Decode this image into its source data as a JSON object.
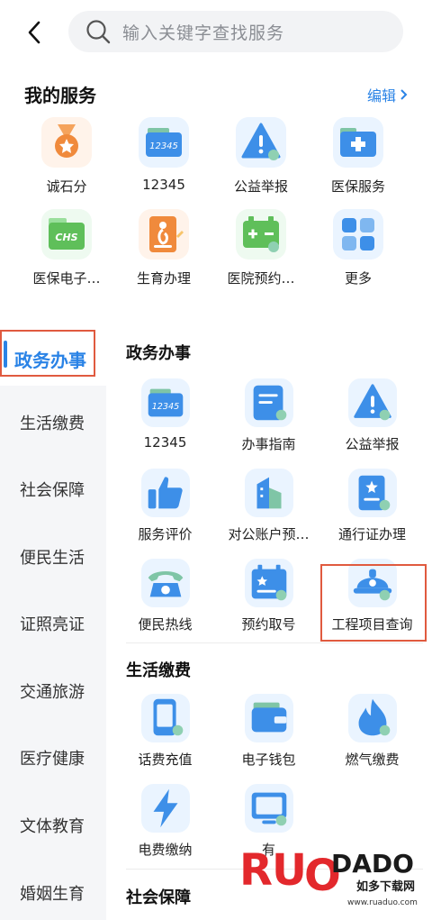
{
  "search": {
    "placeholder": "输入关键字查找服务"
  },
  "my_services": {
    "title": "我的服务",
    "edit_label": "编辑",
    "items": [
      {
        "label": "诚石分",
        "icon": "medal-icon"
      },
      {
        "label": "12345",
        "icon": "hotline-folder-icon"
      },
      {
        "label": "公益举报",
        "icon": "warning-icon"
      },
      {
        "label": "医保服务",
        "icon": "medical-insurance-icon"
      },
      {
        "label": "医保电子…",
        "icon": "chs-card-icon"
      },
      {
        "label": "生育办理",
        "icon": "pregnancy-icon"
      },
      {
        "label": "医院预约…",
        "icon": "battery-calendar-icon"
      },
      {
        "label": "更多",
        "icon": "grid-more-icon"
      }
    ]
  },
  "categories": {
    "active": "政务办事",
    "items": [
      "生活缴费",
      "社会保障",
      "便民生活",
      "证照亮证",
      "交通旅游",
      "医疗健康",
      "文体教育",
      "婚姻生育"
    ]
  },
  "sections": [
    {
      "title": "政务办事",
      "items": [
        {
          "label": "12345",
          "icon": "hotline-folder-icon"
        },
        {
          "label": "办事指南",
          "icon": "guide-doc-icon"
        },
        {
          "label": "公益举报",
          "icon": "warning-icon"
        },
        {
          "label": "服务评价",
          "icon": "thumbs-up-icon"
        },
        {
          "label": "对公账户预…",
          "icon": "building-icon"
        },
        {
          "label": "通行证办理",
          "icon": "pass-card-icon"
        },
        {
          "label": "便民热线",
          "icon": "telephone-icon"
        },
        {
          "label": "预约取号",
          "icon": "calendar-star-icon"
        },
        {
          "label": "工程项目查询",
          "icon": "engineering-helmet-icon"
        }
      ]
    },
    {
      "title": "生活缴费",
      "items": [
        {
          "label": "话费充值",
          "icon": "phone-recharge-icon"
        },
        {
          "label": "电子钱包",
          "icon": "wallet-icon"
        },
        {
          "label": "燃气缴费",
          "icon": "flame-icon"
        },
        {
          "label": "电费缴纳",
          "icon": "lightning-icon"
        },
        {
          "label": "有",
          "icon": "tv-icon"
        }
      ]
    },
    {
      "title": "社会保障"
    }
  ],
  "watermark": {
    "brand": "RUODAO",
    "sub": "如多下载网",
    "url": "www.ruaduo.com"
  },
  "colors": {
    "accent": "#2a83e6",
    "highlight_box": "#e05a3f",
    "icon_blue": "#2a83e6",
    "icon_orange": "#f08a3c",
    "icon_green": "#5fbf5a"
  }
}
